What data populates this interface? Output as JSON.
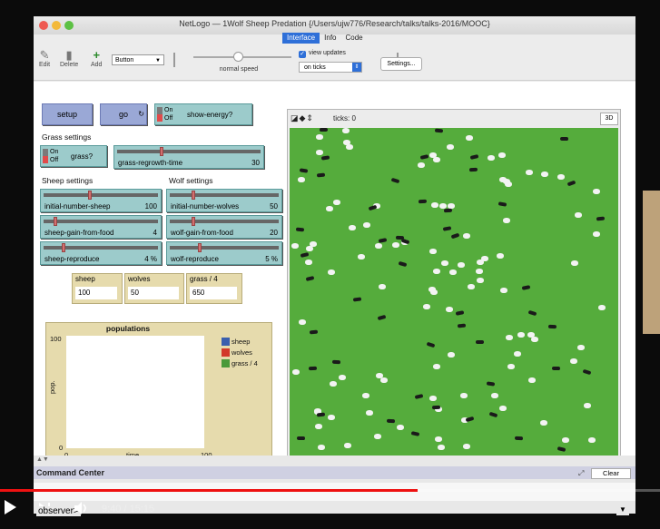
{
  "window": {
    "title": "NetLogo — 1Wolf Sheep Predation {/Users/ujw776/Research/talks/talks-2016/MOOC}"
  },
  "tabs": [
    {
      "label": "Interface",
      "selected": true
    },
    {
      "label": "Info",
      "selected": false
    },
    {
      "label": "Code",
      "selected": false
    }
  ],
  "toolbar": {
    "edit": "Edit",
    "delete": "Delete",
    "add": "Add",
    "widget_type": "Button",
    "speed_label": "normal speed",
    "view_updates": "view updates",
    "view_updates_checked": true,
    "tick_mode": "on ticks",
    "settings": "Settings..."
  },
  "buttons": {
    "setup": "setup",
    "go": "go"
  },
  "switches": {
    "show_energy": {
      "label": "show-energy?",
      "on": "On",
      "off": "Off",
      "state": "off"
    },
    "grass": {
      "label": "grass?",
      "on": "On",
      "off": "Off",
      "state": "off"
    }
  },
  "sections": {
    "grass": "Grass settings",
    "sheep": "Sheep settings",
    "wolf": "Wolf settings"
  },
  "sliders": {
    "grass_regrowth_time": {
      "label": "grass-regrowth-time",
      "value": "30",
      "fraction": 0.3
    },
    "initial_number_sheep": {
      "label": "initial-number-sheep",
      "value": "100",
      "fraction": 0.4
    },
    "initial_number_wolves": {
      "label": "initial-number-wolves",
      "value": "50",
      "fraction": 0.2
    },
    "sheep_gain_from_food": {
      "label": "sheep-gain-from-food",
      "value": "4",
      "fraction": 0.08
    },
    "wolf_gain_from_food": {
      "label": "wolf-gain-from-food",
      "value": "20",
      "fraction": 0.2
    },
    "sheep_reproduce": {
      "label": "sheep-reproduce",
      "value": "4 %",
      "fraction": 0.16
    },
    "wolf_reproduce": {
      "label": "wolf-reproduce",
      "value": "5 %",
      "fraction": 0.26
    }
  },
  "monitors": {
    "sheep": {
      "label": "sheep",
      "value": "100"
    },
    "wolves": {
      "label": "wolves",
      "value": "50"
    },
    "grass": {
      "label": "grass / 4",
      "value": "650"
    }
  },
  "plot": {
    "title": "populations",
    "ylabel": "pop.",
    "xlabel": "time",
    "ymax": "100",
    "ymin": "0",
    "xmin": "0",
    "xmax": "100",
    "legend": [
      {
        "name": "sheep",
        "color": "#3a5fae"
      },
      {
        "name": "wolves",
        "color": "#d23a2a"
      },
      {
        "name": "grass / 4",
        "color": "#4a9a3a"
      }
    ]
  },
  "view": {
    "ticks_label": "ticks: 0",
    "three_d": "3D"
  },
  "command_center": {
    "title": "Command Center",
    "clear": "Clear",
    "observer": "observer>"
  },
  "video": {
    "time": "9:40 / 15:15",
    "progress": 0.633
  }
}
